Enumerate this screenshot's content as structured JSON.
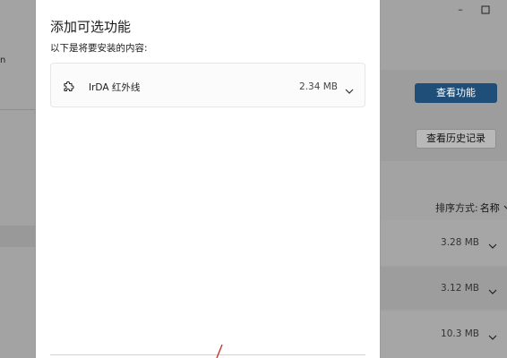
{
  "background": {
    "left_text": "n",
    "view_features_button": "查看功能",
    "view_history_button": "查看历史记录",
    "sort": {
      "label": "排序方式:",
      "value": "名称"
    },
    "rows": [
      {
        "size": "3.28 MB"
      },
      {
        "size": "3.12 MB"
      },
      {
        "size": "10.3 MB"
      }
    ],
    "accent_color": "#1f4f78"
  },
  "dialog": {
    "title": "添加可选功能",
    "subtitle": "以下是将要安装的内容:",
    "feature": {
      "name": "IrDA 红外线",
      "size": "2.34 MB",
      "icon": "puzzle-icon"
    }
  }
}
